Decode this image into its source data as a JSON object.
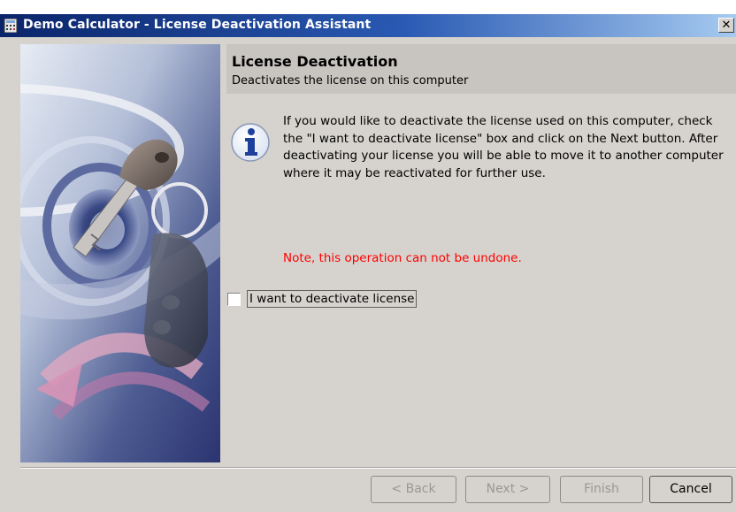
{
  "window": {
    "title": "Demo Calculator - License Deactivation Assistant",
    "close_glyph": "✕"
  },
  "header": {
    "title": "License Deactivation",
    "subtitle": "Deactivates the license on this computer"
  },
  "content": {
    "description": "If you would like to deactivate the license used on this computer, check the \"I want to deactivate license\" box and click on the Next button. After deactivating your license you will be able to move it to another computer where it may be reactivated for further use.",
    "note": "Note, this operation can not be undone.",
    "checkbox_label": "I want to deactivate license",
    "checkbox_checked": false
  },
  "buttons": {
    "back": "< Back",
    "next": "Next >",
    "finish": "Finish",
    "cancel": "Cancel"
  },
  "icons": {
    "app": "calculator-icon",
    "info": "info-icon",
    "close": "close-icon"
  },
  "colors": {
    "title_bar": "#0a246a",
    "note_text": "#ff0000",
    "face": "#d6d3ce"
  }
}
